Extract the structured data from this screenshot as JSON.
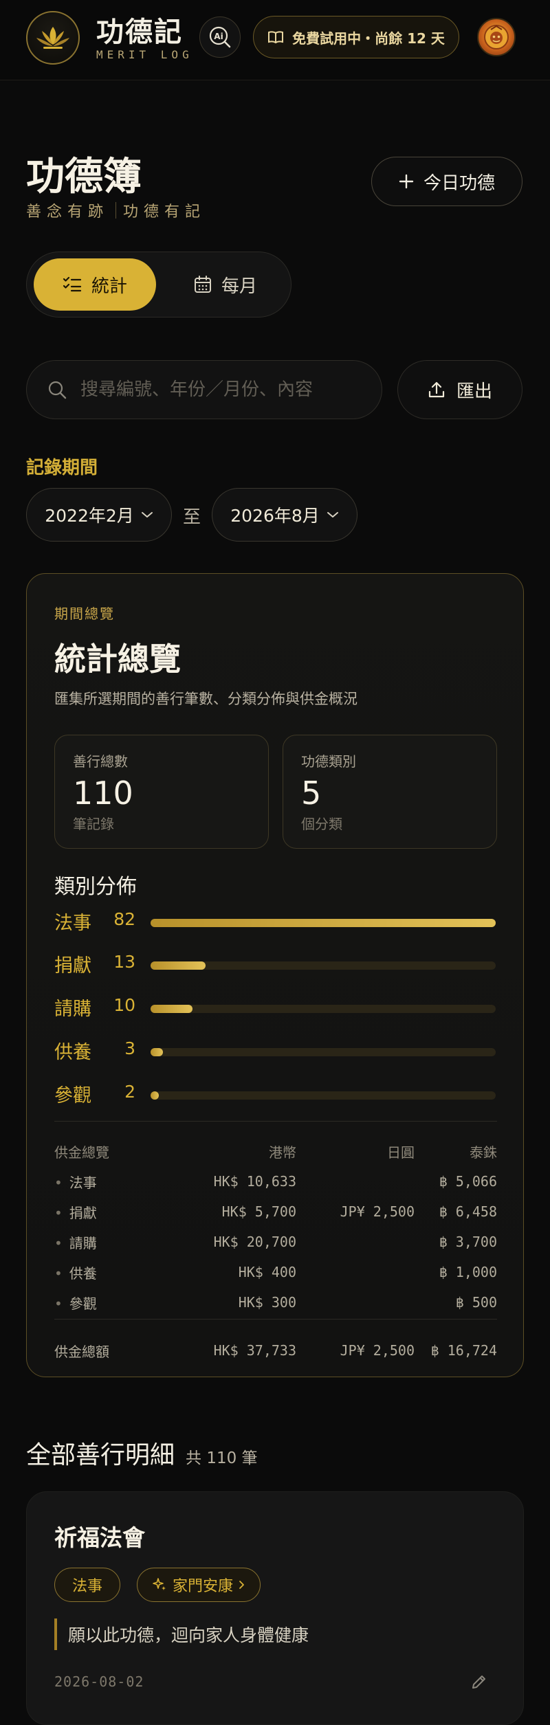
{
  "topbar": {
    "brand_title": "功德記",
    "brand_subtitle": "MERIT LOG",
    "ai_icon_text": "Ai",
    "trial_text": "免費試用中・尚餘 12 天"
  },
  "header": {
    "title": "功德簿",
    "tagline_left": "善念有跡",
    "tagline_right": "功德有記",
    "add_button_label": "今日功德"
  },
  "view_tabs": [
    {
      "label": "統計",
      "active": true
    },
    {
      "label": "每月",
      "active": false
    }
  ],
  "search": {
    "placeholder": "搜尋編號、年份／月份、內容",
    "export_label": "匯出"
  },
  "period": {
    "label": "記錄期間",
    "from": "2022年2月",
    "to_text": "至",
    "to": "2026年8月"
  },
  "stats": {
    "kicker": "期間總覽",
    "title": "統計總覽",
    "description": "匯集所選期間的善行筆數、分類分佈與供金概況",
    "kpis": [
      {
        "label": "善行總數",
        "value": "110",
        "unit": "筆記錄"
      },
      {
        "label": "功德類別",
        "value": "5",
        "unit": "個分類"
      }
    ],
    "distribution_title": "類別分佈",
    "distribution": [
      {
        "name": "法事",
        "count": 82
      },
      {
        "name": "捐獻",
        "count": 13
      },
      {
        "name": "請購",
        "count": 10
      },
      {
        "name": "供養",
        "count": 3
      },
      {
        "name": "參觀",
        "count": 2
      }
    ],
    "donation": {
      "headers": [
        "供金總覽",
        "港幣",
        "日圓",
        "泰銖"
      ],
      "rows": [
        {
          "name": "法事",
          "hkd": "HK$ 10,633",
          "jpy": "",
          "thb": "฿ 5,066"
        },
        {
          "name": "捐獻",
          "hkd": "HK$ 5,700",
          "jpy": "JP¥ 2,500",
          "thb": "฿ 6,458"
        },
        {
          "name": "請購",
          "hkd": "HK$ 20,700",
          "jpy": "",
          "thb": "฿ 3,700"
        },
        {
          "name": "供養",
          "hkd": "HK$ 400",
          "jpy": "",
          "thb": "฿ 1,000"
        },
        {
          "name": "參觀",
          "hkd": "HK$ 300",
          "jpy": "",
          "thb": "฿ 500"
        }
      ],
      "total": {
        "name": "供金總額",
        "hkd": "HK$ 37,733",
        "jpy": "JP¥ 2,500",
        "thb": "฿ 16,724"
      }
    }
  },
  "details": {
    "heading": "全部善行明細",
    "count_text": "共 110 筆",
    "records": [
      {
        "title": "祈福法會",
        "category": "法事",
        "subtag": "家門安康",
        "note": "願以此功德，迴向家人身體健康",
        "date": "2026-08-02"
      }
    ]
  },
  "colors": {
    "accent": "#d9b235",
    "background": "#0b0b0b",
    "card_border": "#5d4f25"
  }
}
